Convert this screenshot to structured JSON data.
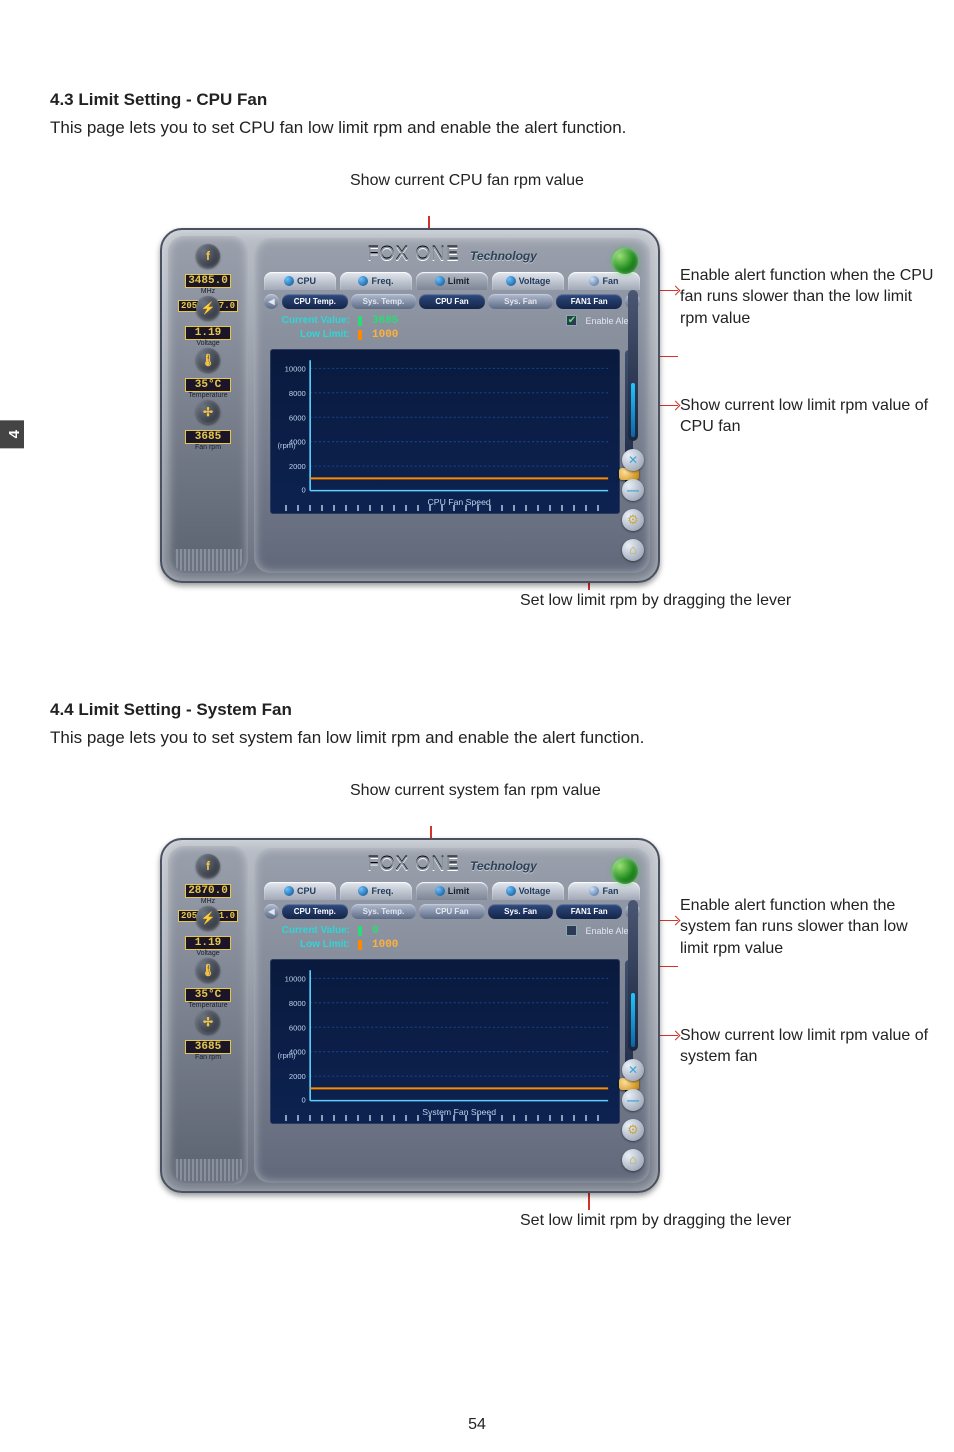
{
  "page_number": "54",
  "chapter_tab": "4",
  "sections": [
    {
      "heading": "4.3 Limit Setting - CPU Fan",
      "body": "This page lets you to set CPU fan low limit rpm and enable the alert function.",
      "callouts": {
        "top": "Show current CPU fan rpm value",
        "r1": "Enable alert function when the CPU fan runs slower than the low limit rpm value",
        "r2": "Show current low limit rpm value of CPU fan",
        "bot": "Set low limit rpm by dragging the lever"
      },
      "app": {
        "brand": "FOX ONE",
        "brand_sub": "Technology",
        "sidebar": {
          "freq": {
            "value": "3485.0",
            "sub": "MHz",
            "fsb": "205 x 17.0"
          },
          "voltage": {
            "value": "1.19",
            "label": "Voltage"
          },
          "temp": {
            "value": "35°C",
            "label": "Temperature"
          },
          "fan": {
            "value": "3685",
            "label": "Fan rpm"
          }
        },
        "tabs": {
          "cpu": "CPU",
          "freq": "Freq.",
          "limit": "Limit",
          "voltage": "Voltage",
          "fan": "Fan"
        },
        "subtabs": {
          "cputemp": "CPU Temp.",
          "systemp": "Sys. Temp.",
          "cpufan": "CPU Fan",
          "sysfan": "Sys. Fan",
          "fan1": "FAN1 Fan"
        },
        "active_subtab": "cpufan",
        "readout": {
          "current_label": "Current Value:",
          "current_value": "3685",
          "lowlimit_label": "Low Limit:",
          "lowlimit_value": "1000",
          "enable_label": "Enable Alert",
          "enable_checked": true
        },
        "chart": {
          "title": "CPU Fan Speed",
          "ylabel_unit": "(rpm)"
        }
      }
    },
    {
      "heading": "4.4 Limit Setting - System Fan",
      "body": "This page lets you to set system fan low limit rpm and enable the alert function.",
      "callouts": {
        "top": "Show current system fan rpm value",
        "r1": "Enable alert function when the system fan runs slower than low limit rpm value",
        "r2": "Show current low limit rpm value of system fan",
        "bot": "Set low limit rpm by dragging the lever"
      },
      "app": {
        "brand": "FOX ONE",
        "brand_sub": "Technology",
        "sidebar": {
          "freq": {
            "value": "2870.0",
            "sub": "MHz",
            "fsb": "205 x 11.0"
          },
          "voltage": {
            "value": "1.19",
            "label": "Voltage"
          },
          "temp": {
            "value": "35°C",
            "label": "Temperature"
          },
          "fan": {
            "value": "3685",
            "label": "Fan rpm"
          }
        },
        "tabs": {
          "cpu": "CPU",
          "freq": "Freq.",
          "limit": "Limit",
          "voltage": "Voltage",
          "fan": "Fan"
        },
        "subtabs": {
          "cputemp": "CPU Temp.",
          "systemp": "Sys. Temp.",
          "cpufan": "CPU Fan",
          "sysfan": "Sys. Fan",
          "fan1": "FAN1 Fan"
        },
        "active_subtab": "sysfan",
        "readout": {
          "current_label": "Current Value:",
          "current_value": "0",
          "lowlimit_label": "Low Limit:",
          "lowlimit_value": "1000",
          "enable_label": "Enable Alert",
          "enable_checked": false
        },
        "chart": {
          "title": "System Fan Speed",
          "ylabel_unit": "(rpm)"
        }
      }
    }
  ],
  "chart_data": [
    {
      "type": "line",
      "title": "CPU Fan Speed",
      "xlabel": "",
      "ylabel": "(rpm)",
      "ylim": [
        0,
        10000
      ],
      "yticks": [
        0,
        2000,
        4000,
        6000,
        8000,
        10000
      ],
      "low_limit_line": 1000,
      "series": [
        {
          "name": "CPU Fan",
          "values": []
        }
      ]
    },
    {
      "type": "line",
      "title": "System Fan Speed",
      "xlabel": "",
      "ylabel": "(rpm)",
      "ylim": [
        0,
        10000
      ],
      "yticks": [
        0,
        2000,
        4000,
        6000,
        8000,
        10000
      ],
      "low_limit_line": 1000,
      "series": [
        {
          "name": "System Fan",
          "values": []
        }
      ]
    }
  ]
}
